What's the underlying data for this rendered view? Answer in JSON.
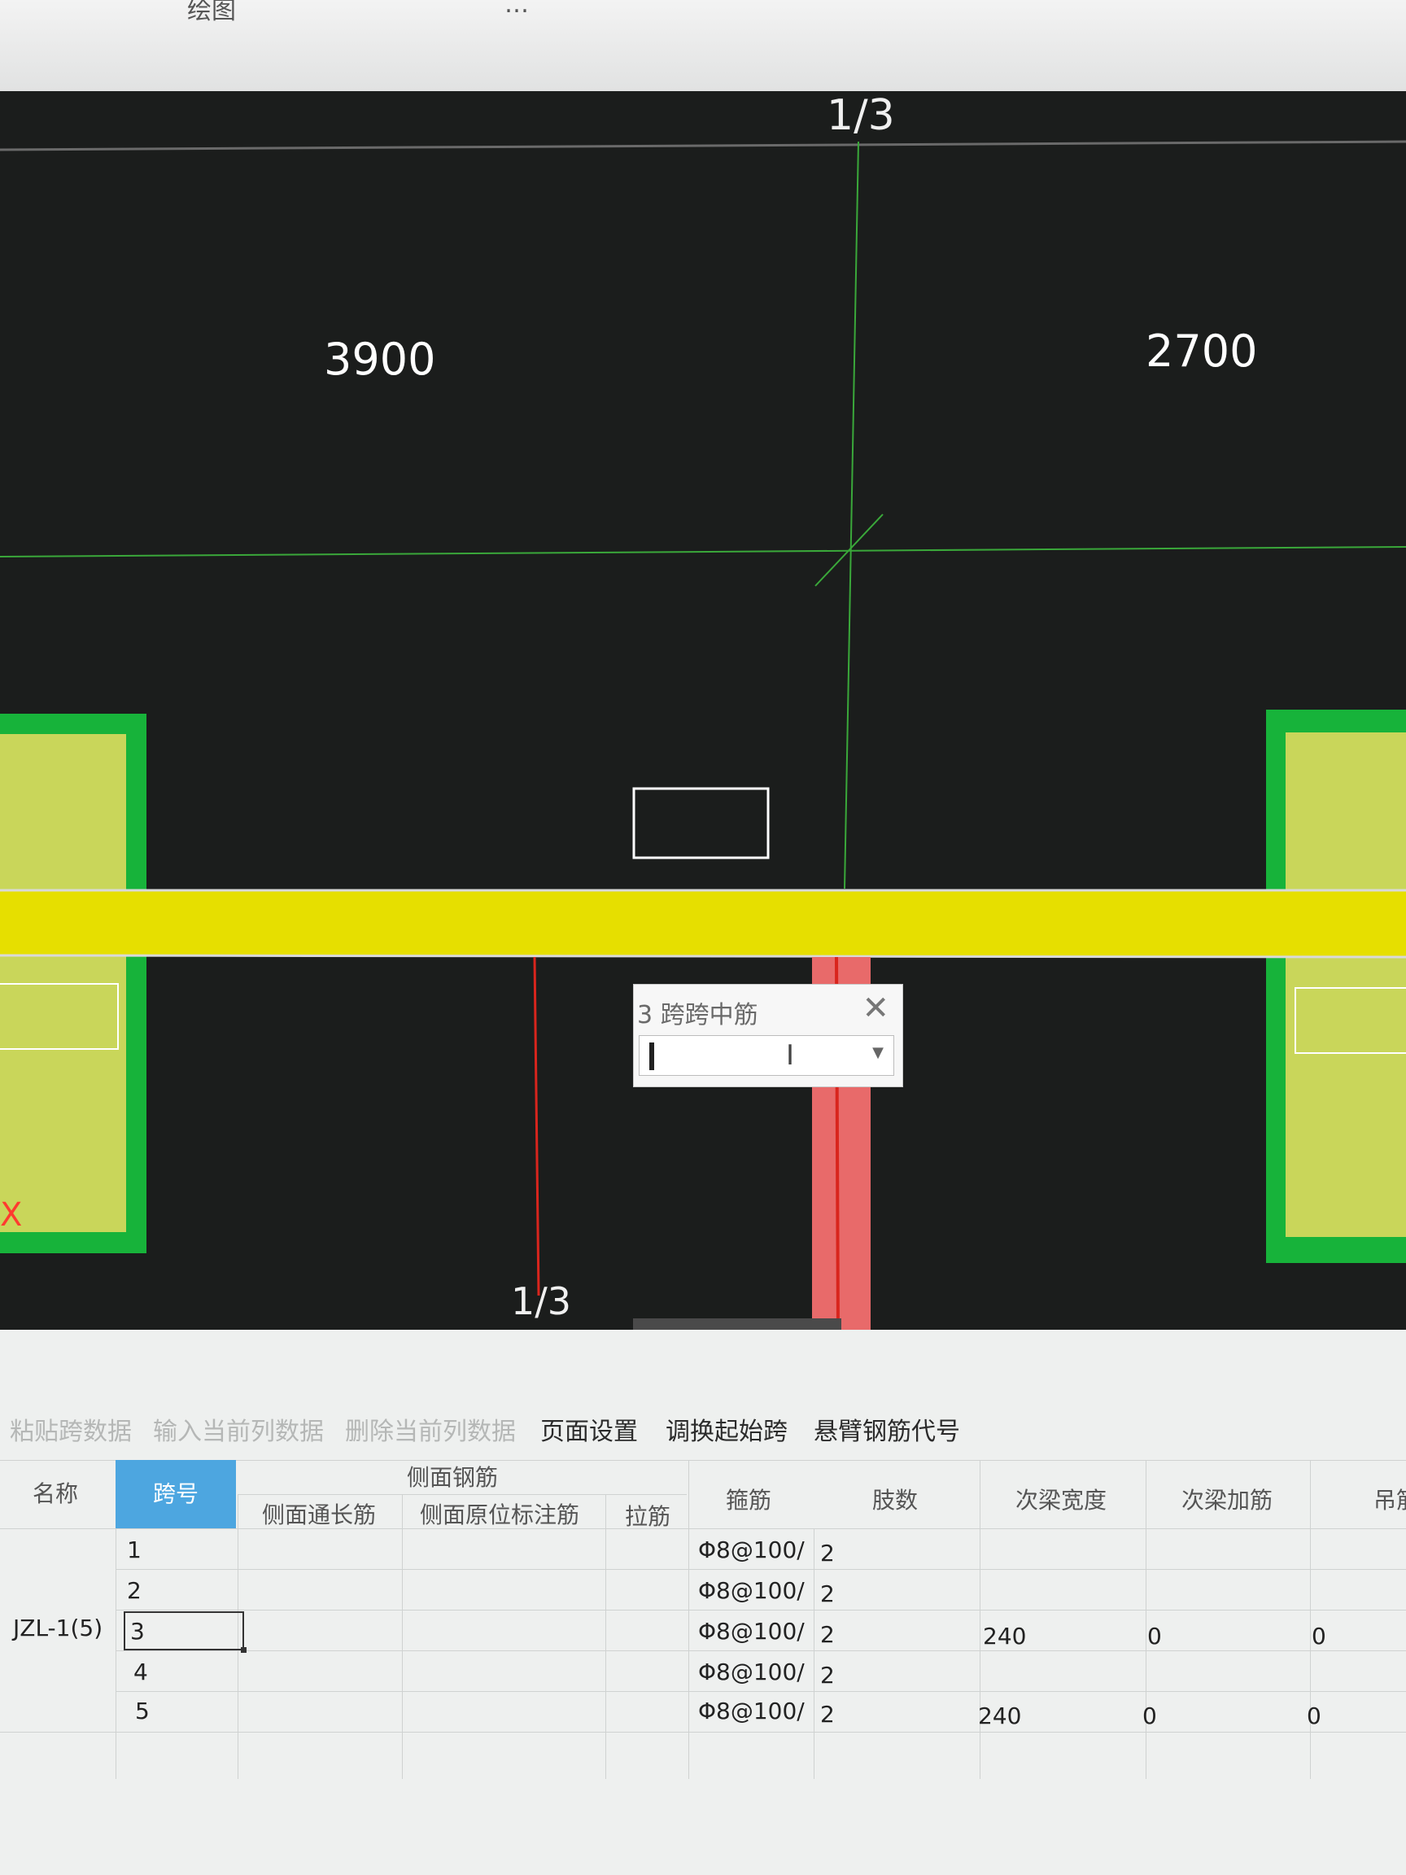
{
  "topbar": {
    "left_text": "绘图",
    "middle_text": "…"
  },
  "canvas": {
    "axis_top": "1/3",
    "axis_bottom": "1/3",
    "dim_left": "3900",
    "dim_right": "2700",
    "x_marker": "X",
    "colors": {
      "beam": "#e6df00",
      "column_fill": "#c9d65a",
      "column_border": "#17b33a",
      "grid_line": "#3aa83a",
      "red_line": "#d9251d"
    }
  },
  "popup": {
    "title": "3 跨跨中筋",
    "close_icon": "close-icon",
    "value": "",
    "dropdown_icon": "chevron-down-icon"
  },
  "toolbar": {
    "items": [
      {
        "label": "粘贴跨数据",
        "enabled": false
      },
      {
        "label": "输入当前列数据",
        "enabled": false
      },
      {
        "label": "删除当前列数据",
        "enabled": false
      },
      {
        "label": "页面设置",
        "enabled": true
      },
      {
        "label": "调换起始跨",
        "enabled": true
      },
      {
        "label": "悬臂钢筋代号",
        "enabled": true
      }
    ]
  },
  "table": {
    "headers": {
      "name": "名称",
      "span": "跨号",
      "side_group": "侧面钢筋",
      "side_long": "侧面通长筋",
      "side_orig": "侧面原位标注筋",
      "tie": "拉筋",
      "stirrup": "箍筋",
      "legs": "肢数",
      "sec_width": "次梁宽度",
      "sec_add": "次梁加筋",
      "hanger": "吊筋"
    },
    "name_value": "JZL-1(5)",
    "selected_span": "3",
    "rows": [
      {
        "span": "1",
        "stirrup": "Φ8@100/",
        "legs": "2",
        "sec_width": "",
        "sec_add": "",
        "hanger": ""
      },
      {
        "span": "2",
        "stirrup": "Φ8@100/",
        "legs": "2",
        "sec_width": "",
        "sec_add": "",
        "hanger": ""
      },
      {
        "span": "3",
        "stirrup": "Φ8@100/",
        "legs": "2",
        "sec_width": "240",
        "sec_add": "0",
        "hanger": "0"
      },
      {
        "span": "4",
        "stirrup": "Φ8@100/",
        "legs": "2",
        "sec_width": "",
        "sec_add": "",
        "hanger": ""
      },
      {
        "span": "5",
        "stirrup": "Φ8@100/",
        "legs": "2",
        "sec_width": "240",
        "sec_add": "0",
        "hanger": "0"
      }
    ]
  }
}
